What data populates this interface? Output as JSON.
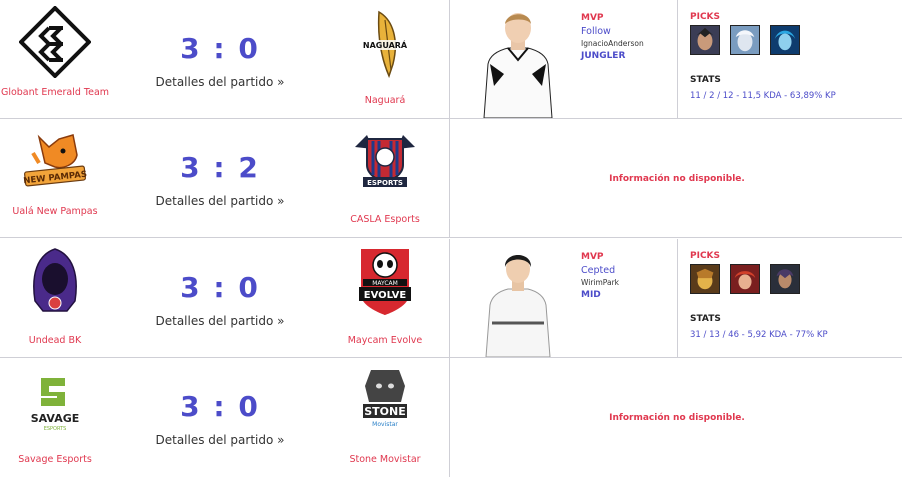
{
  "details_label": "Detalles del partido »",
  "no_info": "Información no disponible.",
  "mvp_label": "MVP",
  "picks_label": "PICKS",
  "stats_label": "STATS",
  "matches": [
    {
      "home": "Globant Emerald Team",
      "away": "Naguará",
      "score": "3 : 0",
      "mvp": {
        "nick": "Follow",
        "real_name": "IgnacioAnderson",
        "role": "JUNGLER",
        "stats": "11 / 2 / 12 - 11,5 KDA - 63,89% KP"
      },
      "picks": [
        "champion-1",
        "champion-2",
        "champion-3"
      ]
    },
    {
      "home": "Ualá New Pampas",
      "away": "CASLA Esports",
      "score": "3 : 2"
    },
    {
      "home": "Undead BK",
      "away": "Maycam Evolve",
      "score": "3 : 0",
      "mvp": {
        "nick": "Cepted",
        "real_name": "WirimPark",
        "role": "MID",
        "stats": "31 / 13 / 46 - 5,92 KDA - 77% KP"
      },
      "picks": [
        "champion-1",
        "champion-2",
        "champion-3"
      ]
    },
    {
      "home": "Savage Esports",
      "away": "Stone Movistar",
      "score": "3 : 0"
    }
  ],
  "logo_texts": {
    "naguara": "NAGUARÁ",
    "new_pampas": "NEW PAMPAS",
    "esports": "ESPORTS",
    "maycam": "MAYCAM",
    "evolve": "EVOLVE",
    "savage": "SAVAGE",
    "savage_sub": "ESPORTS",
    "stone": "STONE",
    "movistar": "Movistar"
  },
  "colors": {
    "accent_red": "#e0384f",
    "accent_blue": "#4c4cc9",
    "divider": "#cfcfd6"
  }
}
